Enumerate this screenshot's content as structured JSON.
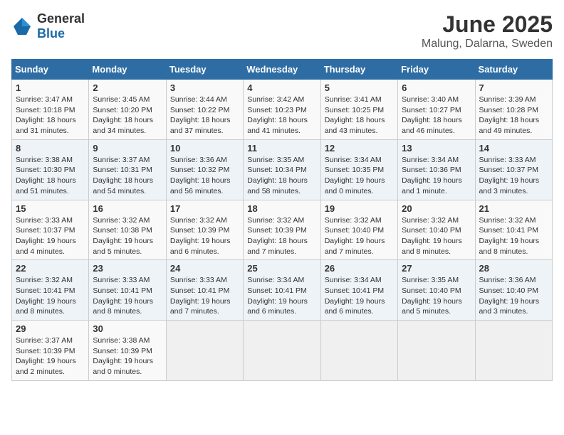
{
  "header": {
    "logo_general": "General",
    "logo_blue": "Blue",
    "title": "June 2025",
    "subtitle": "Malung, Dalarna, Sweden"
  },
  "days_of_week": [
    "Sunday",
    "Monday",
    "Tuesday",
    "Wednesday",
    "Thursday",
    "Friday",
    "Saturday"
  ],
  "weeks": [
    [
      {
        "day": "1",
        "info": "Sunrise: 3:47 AM\nSunset: 10:18 PM\nDaylight: 18 hours\nand 31 minutes."
      },
      {
        "day": "2",
        "info": "Sunrise: 3:45 AM\nSunset: 10:20 PM\nDaylight: 18 hours\nand 34 minutes."
      },
      {
        "day": "3",
        "info": "Sunrise: 3:44 AM\nSunset: 10:22 PM\nDaylight: 18 hours\nand 37 minutes."
      },
      {
        "day": "4",
        "info": "Sunrise: 3:42 AM\nSunset: 10:23 PM\nDaylight: 18 hours\nand 41 minutes."
      },
      {
        "day": "5",
        "info": "Sunrise: 3:41 AM\nSunset: 10:25 PM\nDaylight: 18 hours\nand 43 minutes."
      },
      {
        "day": "6",
        "info": "Sunrise: 3:40 AM\nSunset: 10:27 PM\nDaylight: 18 hours\nand 46 minutes."
      },
      {
        "day": "7",
        "info": "Sunrise: 3:39 AM\nSunset: 10:28 PM\nDaylight: 18 hours\nand 49 minutes."
      }
    ],
    [
      {
        "day": "8",
        "info": "Sunrise: 3:38 AM\nSunset: 10:30 PM\nDaylight: 18 hours\nand 51 minutes."
      },
      {
        "day": "9",
        "info": "Sunrise: 3:37 AM\nSunset: 10:31 PM\nDaylight: 18 hours\nand 54 minutes."
      },
      {
        "day": "10",
        "info": "Sunrise: 3:36 AM\nSunset: 10:32 PM\nDaylight: 18 hours\nand 56 minutes."
      },
      {
        "day": "11",
        "info": "Sunrise: 3:35 AM\nSunset: 10:34 PM\nDaylight: 18 hours\nand 58 minutes."
      },
      {
        "day": "12",
        "info": "Sunrise: 3:34 AM\nSunset: 10:35 PM\nDaylight: 19 hours\nand 0 minutes."
      },
      {
        "day": "13",
        "info": "Sunrise: 3:34 AM\nSunset: 10:36 PM\nDaylight: 19 hours\nand 1 minute."
      },
      {
        "day": "14",
        "info": "Sunrise: 3:33 AM\nSunset: 10:37 PM\nDaylight: 19 hours\nand 3 minutes."
      }
    ],
    [
      {
        "day": "15",
        "info": "Sunrise: 3:33 AM\nSunset: 10:37 PM\nDaylight: 19 hours\nand 4 minutes."
      },
      {
        "day": "16",
        "info": "Sunrise: 3:32 AM\nSunset: 10:38 PM\nDaylight: 19 hours\nand 5 minutes."
      },
      {
        "day": "17",
        "info": "Sunrise: 3:32 AM\nSunset: 10:39 PM\nDaylight: 19 hours\nand 6 minutes."
      },
      {
        "day": "18",
        "info": "Sunrise: 3:32 AM\nSunset: 10:39 PM\nDaylight: 18 hours\nand 7 minutes."
      },
      {
        "day": "19",
        "info": "Sunrise: 3:32 AM\nSunset: 10:40 PM\nDaylight: 19 hours\nand 7 minutes."
      },
      {
        "day": "20",
        "info": "Sunrise: 3:32 AM\nSunset: 10:40 PM\nDaylight: 19 hours\nand 8 minutes."
      },
      {
        "day": "21",
        "info": "Sunrise: 3:32 AM\nSunset: 10:41 PM\nDaylight: 19 hours\nand 8 minutes."
      }
    ],
    [
      {
        "day": "22",
        "info": "Sunrise: 3:32 AM\nSunset: 10:41 PM\nDaylight: 19 hours\nand 8 minutes."
      },
      {
        "day": "23",
        "info": "Sunrise: 3:33 AM\nSunset: 10:41 PM\nDaylight: 19 hours\nand 8 minutes."
      },
      {
        "day": "24",
        "info": "Sunrise: 3:33 AM\nSunset: 10:41 PM\nDaylight: 19 hours\nand 7 minutes."
      },
      {
        "day": "25",
        "info": "Sunrise: 3:34 AM\nSunset: 10:41 PM\nDaylight: 19 hours\nand 6 minutes."
      },
      {
        "day": "26",
        "info": "Sunrise: 3:34 AM\nSunset: 10:41 PM\nDaylight: 19 hours\nand 6 minutes."
      },
      {
        "day": "27",
        "info": "Sunrise: 3:35 AM\nSunset: 10:40 PM\nDaylight: 19 hours\nand 5 minutes."
      },
      {
        "day": "28",
        "info": "Sunrise: 3:36 AM\nSunset: 10:40 PM\nDaylight: 19 hours\nand 3 minutes."
      }
    ],
    [
      {
        "day": "29",
        "info": "Sunrise: 3:37 AM\nSunset: 10:39 PM\nDaylight: 19 hours\nand 2 minutes."
      },
      {
        "day": "30",
        "info": "Sunrise: 3:38 AM\nSunset: 10:39 PM\nDaylight: 19 hours\nand 0 minutes."
      },
      {
        "day": "",
        "info": ""
      },
      {
        "day": "",
        "info": ""
      },
      {
        "day": "",
        "info": ""
      },
      {
        "day": "",
        "info": ""
      },
      {
        "day": "",
        "info": ""
      }
    ]
  ]
}
